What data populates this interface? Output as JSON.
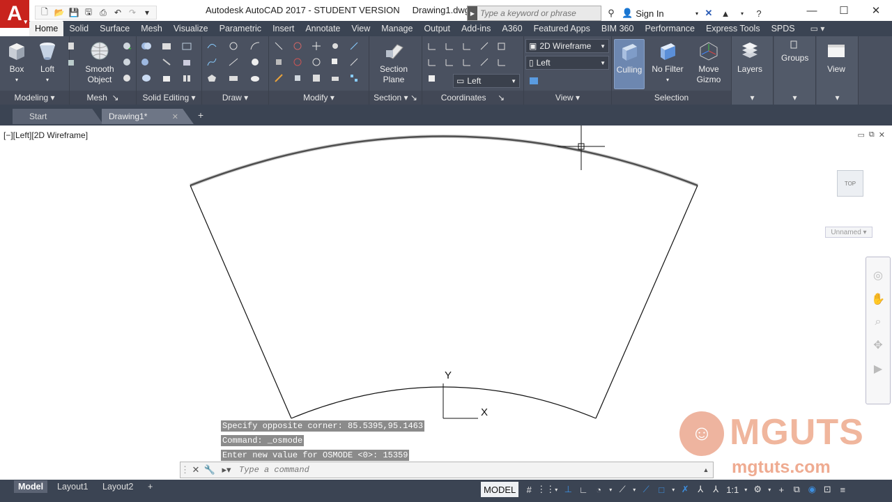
{
  "app": {
    "title": "Autodesk AutoCAD 2017 - STUDENT VERSION",
    "document": "Drawing1.dwg",
    "logo": "A",
    "search_placeholder": "Type a keyword or phrase",
    "sign_in": "Sign In"
  },
  "ribbon_tabs": [
    "Home",
    "Solid",
    "Surface",
    "Mesh",
    "Visualize",
    "Parametric",
    "Insert",
    "Annotate",
    "View",
    "Manage",
    "Output",
    "Add-ins",
    "A360",
    "Featured Apps",
    "BIM 360",
    "Performance",
    "Express Tools",
    "SPDS"
  ],
  "ribbon": {
    "box": "Box",
    "loft": "Loft",
    "smooth_object": "Smooth Object",
    "section_plane": "Section Plane",
    "visual_style": "2D Wireframe",
    "view_name": "Left",
    "ucs_name": "Left",
    "culling": "Culling",
    "no_filter": "No Filter",
    "move_gizmo": "Move Gizmo",
    "layers": "Layers",
    "groups": "Groups",
    "view": "View",
    "panels": [
      "Modeling",
      "Mesh",
      "Solid Editing",
      "Draw",
      "Modify",
      "Section",
      "Coordinates",
      "View",
      "Selection"
    ]
  },
  "file_tabs": [
    "Start",
    "Drawing1*"
  ],
  "viewport": {
    "label": "[−][Left][2D Wireframe]",
    "viewcube": "TOP",
    "ucs_menu": "Unnamed",
    "ucs_x": "X",
    "ucs_y": "Y"
  },
  "command": {
    "history": [
      "Specify opposite corner: 85.5395,95.1463",
      "Command: _osmode",
      "Enter new value for OSMODE <0>: 15359"
    ],
    "placeholder": "Type a command"
  },
  "layout_tabs": [
    "Model",
    "Layout1",
    "Layout2"
  ],
  "status": {
    "model": "MODEL",
    "scale": "1:1"
  },
  "watermark": {
    "title": "MGUTS",
    "url": "mgtuts.com"
  },
  "colors": {
    "ribbon_bg": "#4a5160",
    "tabs_bg": "#3b4453",
    "logo_red": "#c8231d",
    "watermark": "#f0b69d"
  }
}
